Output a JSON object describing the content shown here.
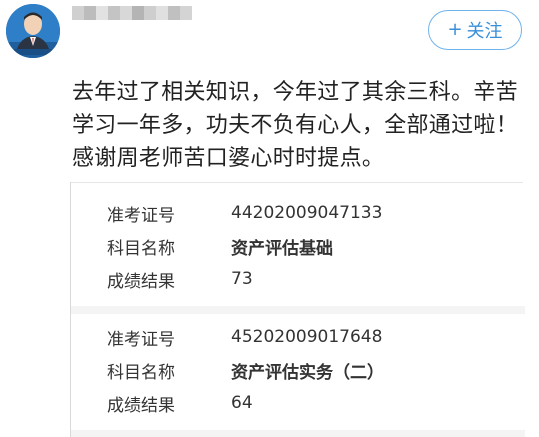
{
  "user": {
    "avatar_caption": "",
    "username_blurred": true
  },
  "follow_button": {
    "plus": "+",
    "label": "关注"
  },
  "post": {
    "lines": [
      "去年过了相关知识，今年过了其余三科。辛苦",
      "学习一年多，功夫不负有心人，全部通过啦！",
      "感谢周老师苦口婆心时时提点。"
    ]
  },
  "records": [
    {
      "exam_no_label": "准考证号",
      "exam_no": "44202009047133",
      "subject_label": "科目名称",
      "subject": "资产评估基础",
      "result_label": "成绩结果",
      "result": "73"
    },
    {
      "exam_no_label": "准考证号",
      "exam_no": "45202009017648",
      "subject_label": "科目名称",
      "subject": "资产评估实务（二）",
      "result_label": "成绩结果",
      "result": "64"
    }
  ],
  "colors": {
    "accent": "#3a8fd8",
    "avatar_bg": "#2f7fc8",
    "text": "#222222"
  }
}
